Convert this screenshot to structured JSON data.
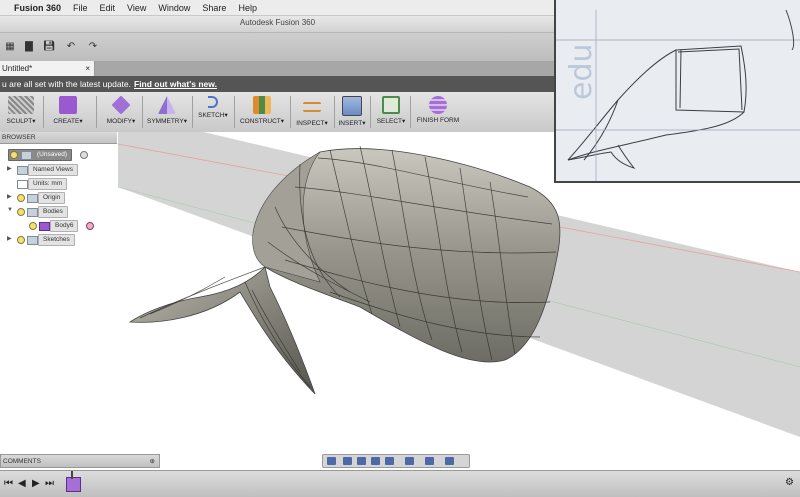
{
  "menubar": {
    "apple": "",
    "app_name": "Fusion 360",
    "items": [
      "File",
      "Edit",
      "View",
      "Window",
      "Share",
      "Help"
    ]
  },
  "window": {
    "title": "Autodesk Fusion 360"
  },
  "document_tab": {
    "label": "Untitled*",
    "close": "×"
  },
  "notice": {
    "text": "u are all set with the latest update.",
    "link": "Find out what's new."
  },
  "toolbar": {
    "workspace": "SCULPT",
    "groups": [
      {
        "label": "CREATE",
        "color": "#9b59d0"
      },
      {
        "label": "MODIFY",
        "color": "#a070d8"
      },
      {
        "label": "SYMMETRY",
        "color": "#8f6dd3"
      },
      {
        "label": "SKETCH",
        "color": "#4a76c4"
      },
      {
        "label": "CONSTRUCT",
        "color": "#e08a2a"
      },
      {
        "label": "INSPECT",
        "color": "#d88a2e"
      },
      {
        "label": "INSERT",
        "color": "#6b8cc0"
      },
      {
        "label": "SELECT",
        "color": "#4c8c46"
      },
      {
        "label": "FINISH FORM",
        "color": "#a46fd6"
      }
    ]
  },
  "browser": {
    "title": "BROWSER",
    "root": "(Unsaved)",
    "items": [
      "Named Views",
      "Units: mm",
      "Origin",
      "Bodies",
      "Body6",
      "Sketches"
    ]
  },
  "comments": {
    "label": "COMMENTS"
  },
  "colors": {
    "notice_bg": "#555555",
    "surface": "#8c8a7e",
    "accent": "#9b59d0"
  }
}
